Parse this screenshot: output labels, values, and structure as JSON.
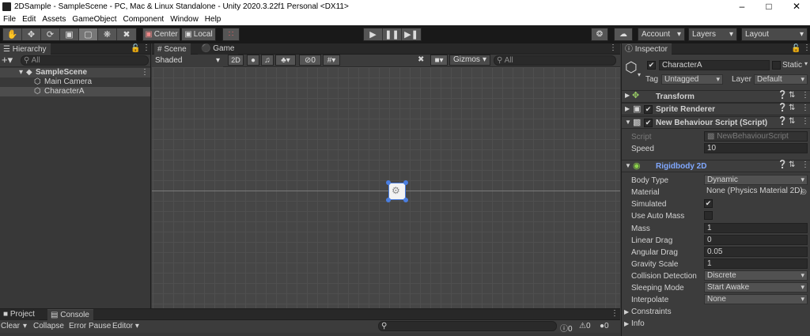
{
  "window": {
    "title": "2DSample - SampleScene - PC, Mac & Linux Standalone - Unity 2020.3.22f1 Personal <DX11>",
    "controls": [
      "–",
      "□",
      "✕"
    ]
  },
  "menubar": [
    "File",
    "Edit",
    "Assets",
    "GameObject",
    "Component",
    "Window",
    "Help"
  ],
  "toolbar": {
    "pivot": "Center",
    "space": "Local",
    "account": "Account",
    "layers": "Layers",
    "layout": "Layout"
  },
  "hierarchy": {
    "tab": "Hierarchy",
    "search_placeholder": "All",
    "scene": "SampleScene",
    "items": [
      "Main Camera",
      "CharacterA"
    ]
  },
  "scene": {
    "tabs": [
      "Scene",
      "Game"
    ],
    "shading": "Shaded",
    "mode2d": "2D",
    "fx_count": "0",
    "gizmos": "Gizmos",
    "search_placeholder": "All"
  },
  "console": {
    "tabs": [
      "Project",
      "Console"
    ],
    "clear": "Clear",
    "collapse": "Collapse",
    "error_pause": "Error Pause",
    "editor": "Editor",
    "counts": [
      "0",
      "0",
      "0"
    ]
  },
  "inspector": {
    "tab": "Inspector",
    "object_name": "CharacterA",
    "static_label": "Static",
    "tag_label": "Tag",
    "tag_value": "Untagged",
    "layer_label": "Layer",
    "layer_value": "Default",
    "components": {
      "transform": "Transform",
      "sprite_renderer": "Sprite Renderer",
      "script": "New Behaviour Script (Script)",
      "rigidbody": "Rigidbody 2D"
    },
    "script_fields": {
      "script_label": "Script",
      "script_value": "NewBehaviourScript",
      "speed_label": "Speed",
      "speed_value": "10"
    },
    "rigidbody_fields": [
      {
        "label": "Body Type",
        "value": "Dynamic"
      },
      {
        "label": "Material",
        "value": "None (Physics Material 2D)"
      },
      {
        "label": "Simulated",
        "value": "✔"
      },
      {
        "label": "Use Auto Mass",
        "value": ""
      },
      {
        "label": "Mass",
        "value": "1"
      },
      {
        "label": "Linear Drag",
        "value": "0"
      },
      {
        "label": "Angular Drag",
        "value": "0.05"
      },
      {
        "label": "Gravity Scale",
        "value": "1"
      },
      {
        "label": "Collision Detection",
        "value": "Discrete"
      },
      {
        "label": "Sleeping Mode",
        "value": "Start Awake"
      },
      {
        "label": "Interpolate",
        "value": "None"
      }
    ],
    "constraints": "Constraints",
    "info": "Info"
  }
}
